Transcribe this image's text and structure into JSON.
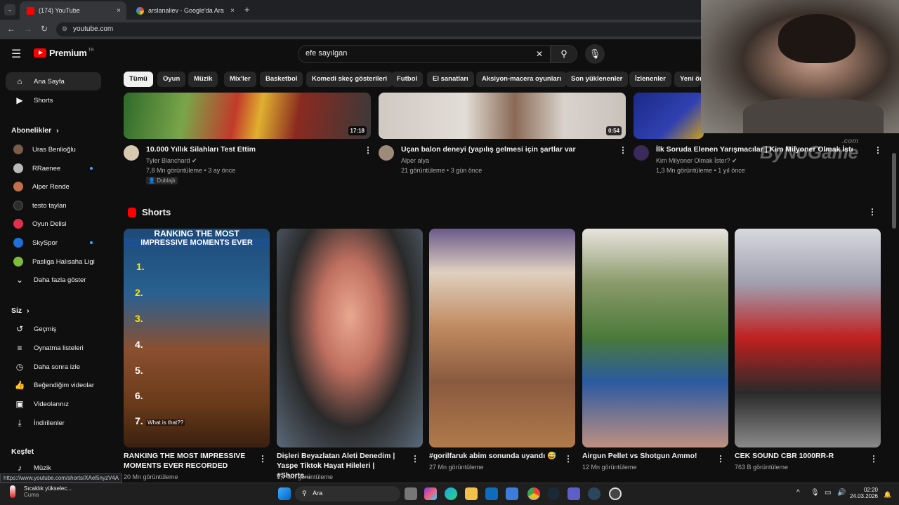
{
  "browser": {
    "tabs": [
      {
        "label": "(174) YouTube",
        "close": "×"
      },
      {
        "label": "arslanaliev - Google'da Ara",
        "close": "×"
      }
    ],
    "new_tab": "+",
    "url": "youtube.com",
    "status_url": "https://www.youtube.com/shorts/XAel5nyzV4A"
  },
  "header": {
    "logo": "Premium",
    "region": "TR",
    "search_value": "efe sayılgan",
    "clear": "✕"
  },
  "chips": [
    "Tümü",
    "Oyun",
    "Müzik",
    "Mix'ler",
    "Basketbol",
    "Komedi skeç gösterileri",
    "Futbol",
    "El sanatları",
    "Aksiyon-macera oyunları",
    "Son yüklenenler",
    "İzlenenler",
    "Yeni ör"
  ],
  "sidebar": {
    "main": [
      {
        "label": "Ana Sayfa",
        "icon": "home-icon"
      },
      {
        "label": "Shorts",
        "icon": "shorts-icon"
      }
    ],
    "subs_header": "Abonelikler",
    "subs": [
      {
        "label": "Uras Benlioğlu",
        "color": "#7a5c4a",
        "live": false
      },
      {
        "label": "RRaenee",
        "color": "#b9b9b9",
        "live": true
      },
      {
        "label": "Alper Rende",
        "color": "#c0704a",
        "live": false
      },
      {
        "label": "testo taylan",
        "color": "#2d2d2d",
        "live": false
      },
      {
        "label": "Oyun Delisi",
        "color": "#e3304a",
        "live": false
      },
      {
        "label": "SkySpor",
        "color": "#1f6fd6",
        "live": true
      },
      {
        "label": "Pasliga Halısaha Ligi",
        "color": "#7dbb3a",
        "live": false
      }
    ],
    "more": "Daha fazla göster",
    "you_header": "Siz",
    "you": [
      {
        "label": "Geçmiş",
        "icon": "history-icon"
      },
      {
        "label": "Oynatma listeleri",
        "icon": "playlist-icon"
      },
      {
        "label": "Daha sonra izle",
        "icon": "clock-icon"
      },
      {
        "label": "Beğendiğim videolar",
        "icon": "like-icon"
      },
      {
        "label": "Videolarınız",
        "icon": "video-icon"
      },
      {
        "label": "İndirilenler",
        "icon": "download-icon"
      }
    ],
    "explore_header": "Keşfet",
    "explore": [
      {
        "label": "Müzik",
        "icon": "music-icon"
      }
    ]
  },
  "videos": [
    {
      "title": "10.000 Yıllık Silahları Test Ettim",
      "channel": "Tyler Blanchard",
      "meta": "7,8 Mn görüntüleme • 3 ay önce",
      "badge": "Dublajlı",
      "duration": "17:18"
    },
    {
      "title": "Uçan balon deneyi (yapılış gelmesi için şartlar var",
      "channel": "Alper alya",
      "meta": "21 görüntüleme • 3 gün önce",
      "duration": "0:54"
    },
    {
      "title": "İlk Soruda Elenen Yarışmacılar | Kim Milyoner Olmak İster?",
      "channel": "Kim Milyoner Olmak İster?",
      "meta": "1,3 Mn görüntüleme • 1 yıl önce"
    }
  ],
  "shorts_section": {
    "title": "Shorts"
  },
  "shorts": [
    {
      "title": "RANKING THE MOST IMPRESSIVE MOMENTS EVER RECORDED",
      "views": "20 Mn görüntüleme",
      "overlay1": "RANKING THE MOST",
      "overlay2": "IMPRESSIVE MOMENTS EVER",
      "overlay_nums": [
        "1.",
        "2.",
        "3.",
        "4.",
        "5.",
        "6.",
        "7."
      ],
      "overlay_caption": "What is that??"
    },
    {
      "title": "Dişleri Beyazlatan Aleti Denedim | Yaspe Tiktok Hayat Hileleri | #Shorts...",
      "views": "1,7 Mn görüntüleme"
    },
    {
      "title": "#gorilfaruk abim sonunda uyandı 😅",
      "views": "27 Mn görüntüleme"
    },
    {
      "title": "Airgun Pellet vs Shotgun Ammo!",
      "views": "12 Mn görüntüleme"
    },
    {
      "title": "CEK SOUND CBR 1000RR-R",
      "views": "763 B görüntüleme"
    }
  ],
  "watermark": "ByNoGame",
  "watermark_sub": ".com",
  "taskbar": {
    "weather_title": "Sıcaklık yükselec...",
    "weather_sub": "Cuma",
    "search": "Ara",
    "time": "02:20",
    "date": "24.03.2026"
  }
}
